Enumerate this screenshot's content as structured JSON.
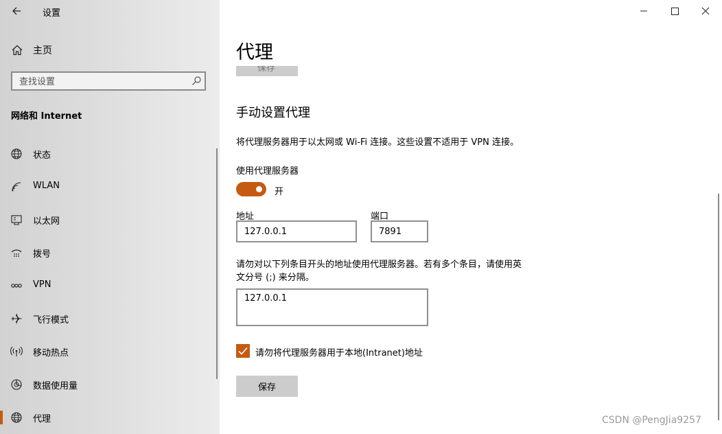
{
  "window": {
    "title": "设置",
    "controls": {
      "minimize": "minimize-icon",
      "maximize": "maximize-icon",
      "close": "close-icon"
    }
  },
  "sidebar": {
    "home_label": "主页",
    "search_placeholder": "查找设置",
    "section_title": "网络和 Internet",
    "selected_item": "代理",
    "items": [
      {
        "label": "状态",
        "icon": "globe-status-icon"
      },
      {
        "label": "WLAN",
        "icon": "wifi-icon"
      },
      {
        "label": "以太网",
        "icon": "ethernet-icon"
      },
      {
        "label": "拨号",
        "icon": "dialup-icon"
      },
      {
        "label": "VPN",
        "icon": "vpn-icon"
      },
      {
        "label": "飞行模式",
        "icon": "airplane-icon"
      },
      {
        "label": "移动热点",
        "icon": "hotspot-icon"
      },
      {
        "label": "数据使用量",
        "icon": "data-usage-icon"
      },
      {
        "label": "代理",
        "icon": "globe-icon"
      }
    ]
  },
  "main": {
    "page_title": "代理",
    "ghost_save_label": "保存",
    "section_heading": "手动设置代理",
    "description": "将代理服务器用于以太网或 Wi-Fi 连接。这些设置不适用于 VPN 连接。",
    "use_proxy_label": "使用代理服务器",
    "toggle_state": "开",
    "toggle_on": true,
    "address_label": "地址",
    "address_value": "127.0.0.1",
    "port_label": "端口",
    "port_value": "7891",
    "exceptions_desc_line1": "请勿对以下列条目开头的地址使用代理服务器。若有多个条目，请使用英",
    "exceptions_desc_line2": "文分号 (;) 来分隔。",
    "exceptions_value": "127.0.0.1",
    "bypass_local_label": "请勿将代理服务器用于本地(Intranet)地址",
    "bypass_local_checked": true,
    "save_label": "保存"
  },
  "colors": {
    "accent": "#c55a11",
    "button_gray": "#cccccc"
  },
  "watermark": "CSDN @PengJia9257"
}
